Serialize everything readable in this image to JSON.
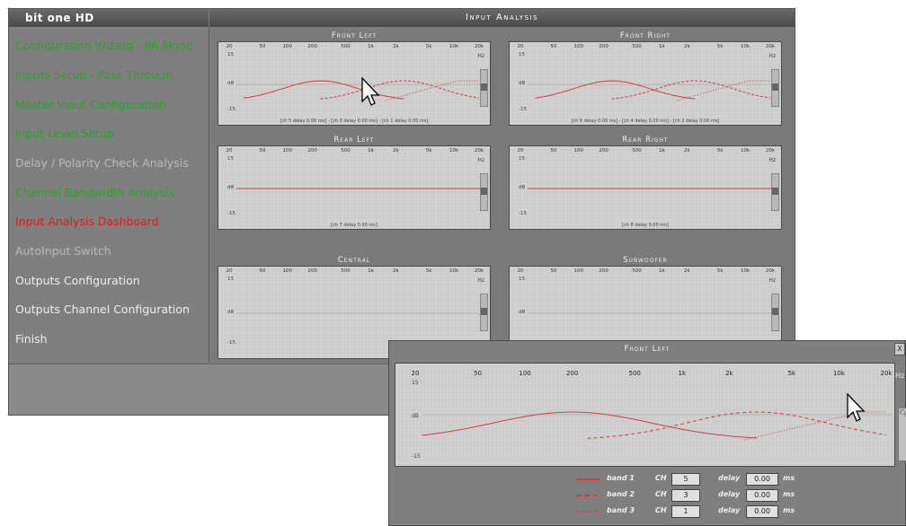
{
  "app": {
    "title": "bit one HD",
    "section_title": "Input Analysis"
  },
  "sidebar": {
    "items": [
      {
        "label": "Configuration Wizard - IIR Mode",
        "color": "green"
      },
      {
        "label": "Inputs Setup - Pass Through",
        "color": "green"
      },
      {
        "label": "Master Input Configuration",
        "color": "green"
      },
      {
        "label": "Input Level Setup",
        "color": "green"
      },
      {
        "label": "Delay / Polarity Check Analysis",
        "color": "gray"
      },
      {
        "label": "Channel Bandwidth Analysis",
        "color": "green"
      },
      {
        "label": "Input Analysis Dashboard",
        "color": "red"
      },
      {
        "label": "AutoInput Switch",
        "color": "gray"
      },
      {
        "label": "Outputs Configuration",
        "color": "white"
      },
      {
        "label": "Outputs Channel Configuration",
        "color": "white"
      },
      {
        "label": "Finish",
        "color": "white"
      }
    ]
  },
  "graph_axis": {
    "frequencies": [
      "20",
      "50",
      "100",
      "200",
      "500",
      "1k",
      "2k",
      "5k",
      "10k",
      "20k"
    ],
    "unit_hz": "Hz",
    "db_label": "dB",
    "db_top": "15",
    "db_bottom": "-15"
  },
  "panels": [
    {
      "title": "Front Left",
      "channels_label": "[ch 5 delay 0.00 ms] - [ch 3 delay 0.00 ms] - [ch 1 delay 0.00 ms]",
      "curves": "three"
    },
    {
      "title": "Front Right",
      "channels_label": "[ch 6 delay 0.00 ms] - [ch 4 delay 0.00 ms] - [ch 2 delay 0.00 ms]",
      "curves": "three"
    },
    {
      "title": "Rear Left",
      "channels_label": "[ch 7 delay 0.00 ms]",
      "curves": "flat"
    },
    {
      "title": "Rear Right",
      "channels_label": "[ch 8 delay 0.00 ms]",
      "curves": "flat"
    },
    {
      "title": "Central",
      "channels_label": "",
      "curves": "none"
    },
    {
      "title": "Subwoofer",
      "channels_label": "",
      "curves": "none"
    }
  ],
  "detail": {
    "title": "Front Left",
    "close_label": "X",
    "unit_hz": "Hz",
    "db_label": "dB",
    "db_top": "15",
    "db_bottom": "-15",
    "zoom_icon": "magnifier-icon",
    "ch_label": "CH",
    "delay_label": "delay",
    "ms_label": "ms",
    "bands": [
      {
        "label": "band 1",
        "ch": "5",
        "delay": "0.00",
        "style": "solid"
      },
      {
        "label": "band 2",
        "ch": "3",
        "delay": "0.00",
        "style": "dashed"
      },
      {
        "label": "band 3",
        "ch": "1",
        "delay": "0.00",
        "style": "dotted"
      }
    ]
  },
  "colors": {
    "curve": "#d04040",
    "accent_red": "#d22020",
    "accent_green": "#2fa02f"
  }
}
